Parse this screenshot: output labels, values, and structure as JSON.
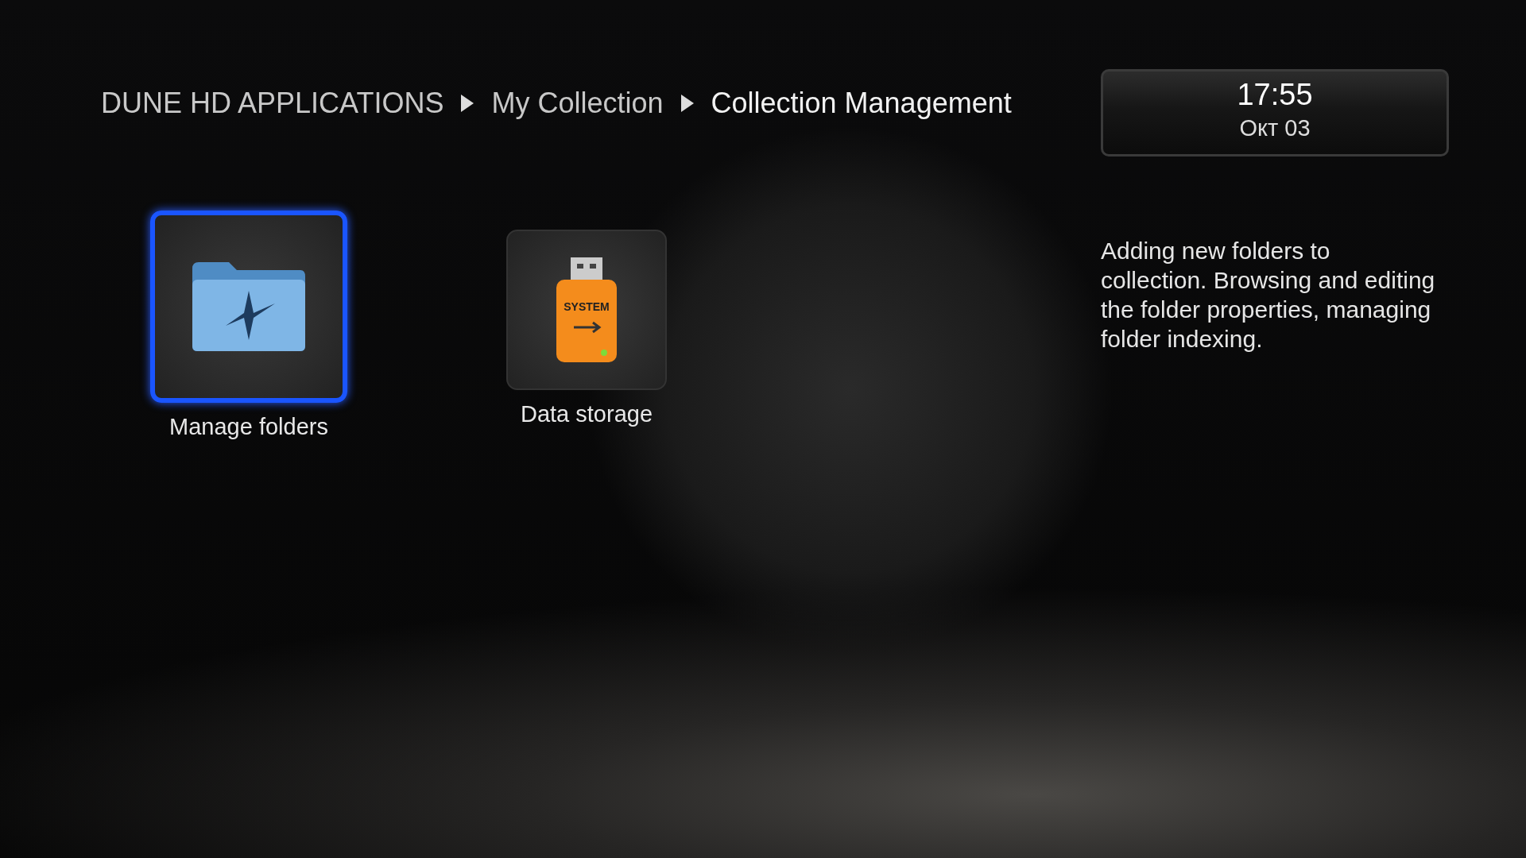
{
  "breadcrumb": [
    "DUNE HD APPLICATIONS",
    "My Collection",
    "Collection Management"
  ],
  "clock": {
    "time": "17:55",
    "date": "Окт 03"
  },
  "tiles": [
    {
      "kind": "folder",
      "label": "Manage folders",
      "selected": true
    },
    {
      "kind": "usb",
      "label": "Data storage",
      "selected": false,
      "badge": "SYSTEM"
    }
  ],
  "description": "Adding new folders to collection. Browsing and editing the folder properties, managing folder indexing."
}
